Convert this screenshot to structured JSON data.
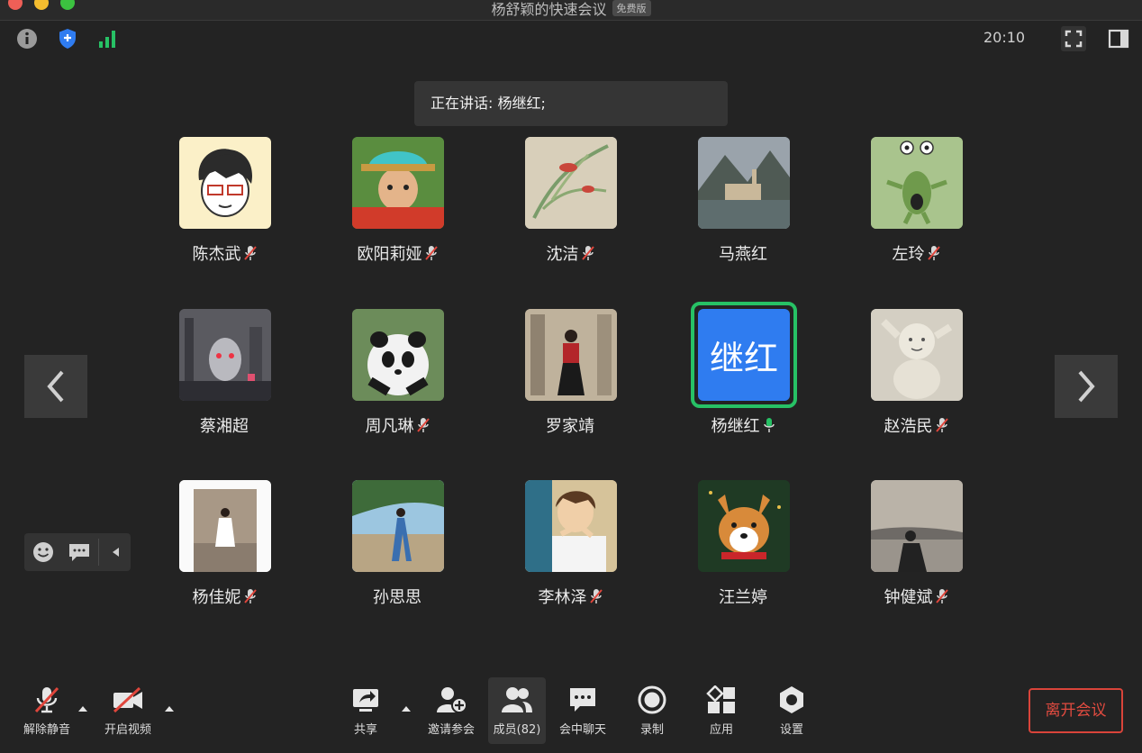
{
  "window": {
    "title": "杨舒颖的快速会议",
    "badge": "免费版"
  },
  "status": {
    "time": "20:10"
  },
  "speaking": {
    "text": "正在讲话: 杨继红;"
  },
  "participants": [
    {
      "name": "陈杰武",
      "mic": "muted",
      "avatar": "cartoon-man"
    },
    {
      "name": "欧阳莉娅",
      "mic": "muted",
      "avatar": "boy-hat"
    },
    {
      "name": "沈洁",
      "mic": "muted",
      "avatar": "painting"
    },
    {
      "name": "马燕红",
      "mic": "none",
      "avatar": "lake-town"
    },
    {
      "name": "左玲",
      "mic": "muted",
      "avatar": "green-monster"
    },
    {
      "name": "蔡湘超",
      "mic": "none",
      "avatar": "robot-city"
    },
    {
      "name": "周凡琳",
      "mic": "muted",
      "avatar": "panda"
    },
    {
      "name": "罗家靖",
      "mic": "none",
      "avatar": "woman-museum"
    },
    {
      "name": "杨继红",
      "mic": "active",
      "avatar": "text",
      "avatar_text": "继红"
    },
    {
      "name": "赵浩民",
      "mic": "muted",
      "avatar": "statue"
    },
    {
      "name": "杨佳妮",
      "mic": "muted",
      "avatar": "woman-stairs"
    },
    {
      "name": "孙思思",
      "mic": "none",
      "avatar": "beach-woman"
    },
    {
      "name": "李林泽",
      "mic": "muted",
      "avatar": "anime-boy"
    },
    {
      "name": "汪兰婷",
      "mic": "none",
      "avatar": "corgi"
    },
    {
      "name": "钟健斌",
      "mic": "muted",
      "avatar": "sunset-man"
    }
  ],
  "toolbar": {
    "unmute": "解除静音",
    "start_video": "开启视频",
    "share": "共享",
    "invite": "邀请参会",
    "members": "成员(82)",
    "chat": "会中聊天",
    "record": "录制",
    "apps": "应用",
    "settings": "设置",
    "leave": "离开会议"
  },
  "colors": {
    "background": "#232323",
    "active_speaker": "#27c165",
    "leave": "#e24b40",
    "muted": "#e0463c",
    "accent_blue": "#2f7cf0"
  }
}
